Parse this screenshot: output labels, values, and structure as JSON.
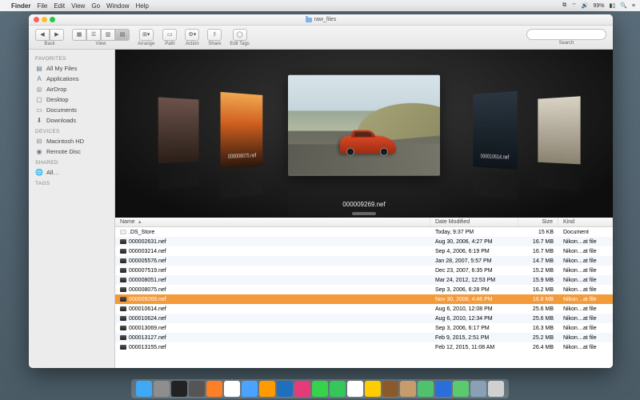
{
  "menubar": {
    "app": "Finder",
    "items": [
      "File",
      "Edit",
      "View",
      "Go",
      "Window",
      "Help"
    ],
    "battery": "99%",
    "time": ""
  },
  "window": {
    "title": "raw_files"
  },
  "toolbar": {
    "back_label": "Back",
    "view_label": "View",
    "arrange_label": "Arrange",
    "path_label": "Path",
    "action_label": "Action",
    "share_label": "Share",
    "edit_tags_label": "Edit Tags",
    "search_label": "Search",
    "search_placeholder": ""
  },
  "sidebar": {
    "sections": [
      {
        "header": "Favorites",
        "items": [
          {
            "icon": "files",
            "label": "All My Files"
          },
          {
            "icon": "app",
            "label": "Applications"
          },
          {
            "icon": "airdrop",
            "label": "AirDrop"
          },
          {
            "icon": "desktop",
            "label": "Desktop"
          },
          {
            "icon": "doc",
            "label": "Documents"
          },
          {
            "icon": "download",
            "label": "Downloads"
          }
        ]
      },
      {
        "header": "Devices",
        "items": [
          {
            "icon": "hd",
            "label": "Macintosh HD"
          },
          {
            "icon": "disc",
            "label": "Remote Disc"
          }
        ]
      },
      {
        "header": "Shared",
        "items": [
          {
            "icon": "globe",
            "label": "All…"
          }
        ]
      },
      {
        "header": "Tags",
        "items": []
      }
    ]
  },
  "coverflow": {
    "center_caption": "000009269.nef",
    "left_caption": "000008075.nef",
    "right_caption": "000010614.nef"
  },
  "list": {
    "columns": {
      "name": "Name",
      "date": "Date Modified",
      "size": "Size",
      "kind": "Kind"
    },
    "rows": [
      {
        "name": ".DS_Store",
        "date": "Today, 9:37 PM",
        "size": "15 KB",
        "kind": "Document",
        "doc": true
      },
      {
        "name": "000002631.nef",
        "date": "Aug 30, 2006, 4:27 PM",
        "size": "16.7 MB",
        "kind": "Nikon…at file"
      },
      {
        "name": "000003214.nef",
        "date": "Sep 4, 2006, 6:19 PM",
        "size": "16.7 MB",
        "kind": "Nikon…at file"
      },
      {
        "name": "000005576.nef",
        "date": "Jan 28, 2007, 5:57 PM",
        "size": "14.7 MB",
        "kind": "Nikon…at file"
      },
      {
        "name": "000007519.nef",
        "date": "Dec 23, 2007, 6:35 PM",
        "size": "15.2 MB",
        "kind": "Nikon…at file"
      },
      {
        "name": "000008051.nef",
        "date": "Mar 24, 2012, 12:53 PM",
        "size": "15.9 MB",
        "kind": "Nikon…at file"
      },
      {
        "name": "000008075.nef",
        "date": "Sep 3, 2006, 6:28 PM",
        "size": "16.2 MB",
        "kind": "Nikon…at file"
      },
      {
        "name": "000009269.nef",
        "date": "Nov 30, 2008, 4:46 PM",
        "size": "16.8 MB",
        "kind": "Nikon…at file",
        "selected": true
      },
      {
        "name": "000010614.nef",
        "date": "Aug 6, 2010, 12:08 PM",
        "size": "25.6 MB",
        "kind": "Nikon…at file"
      },
      {
        "name": "000010624.nef",
        "date": "Aug 6, 2010, 12:34 PM",
        "size": "25.6 MB",
        "kind": "Nikon…at file"
      },
      {
        "name": "000013069.nef",
        "date": "Sep 3, 2006, 6:17 PM",
        "size": "16.3 MB",
        "kind": "Nikon…at file"
      },
      {
        "name": "000013127.nef",
        "date": "Feb 9, 2015, 2:51 PM",
        "size": "25.2 MB",
        "kind": "Nikon…at file"
      },
      {
        "name": "000013155.nef",
        "date": "Feb 12, 2015, 11:08 AM",
        "size": "26.4 MB",
        "kind": "Nikon…at file"
      }
    ]
  },
  "dock": {
    "items": [
      "finder",
      "launchpad",
      "terminal",
      "activity",
      "firefox",
      "chrome",
      "safari",
      "illustrator",
      "photoshop",
      "indesign",
      "messages",
      "facetime",
      "calendar",
      "photos",
      "guitar",
      "contacts",
      "maps",
      "1password",
      "atom",
      "preview",
      "trash"
    ]
  },
  "colors": {
    "selection": "#f39a3a"
  }
}
